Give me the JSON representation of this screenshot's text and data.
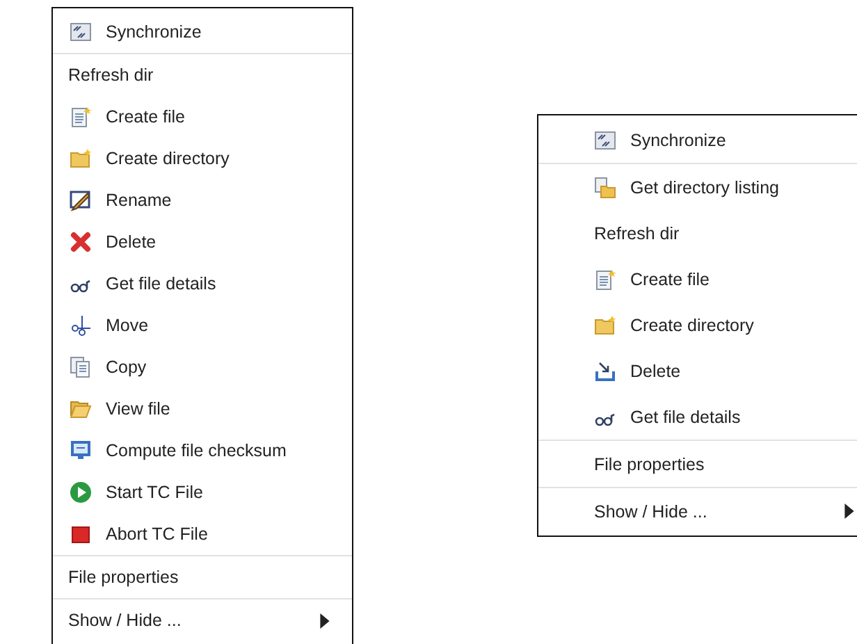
{
  "menus": [
    {
      "sections": [
        [
          {
            "label": "Synchronize",
            "kind": "sync"
          }
        ],
        [
          {
            "label": "Refresh dir"
          },
          {
            "label": "Create file",
            "kind": "newfile"
          },
          {
            "label": "Create directory",
            "kind": "newfolder"
          },
          {
            "label": "Rename",
            "kind": "rename"
          },
          {
            "label": "Delete",
            "kind": "cross"
          },
          {
            "label": "Get file details",
            "kind": "glasses"
          },
          {
            "label": "Move",
            "kind": "scissors"
          },
          {
            "label": "Copy",
            "kind": "copy"
          },
          {
            "label": "View file",
            "kind": "openfolder"
          },
          {
            "label": "Compute file checksum",
            "kind": "monitor"
          },
          {
            "label": "Start TC File",
            "kind": "play"
          },
          {
            "label": "Abort TC File",
            "kind": "stop"
          }
        ],
        [
          {
            "label": "File properties"
          }
        ],
        [
          {
            "label": "Show / Hide ...",
            "submenu": true
          }
        ]
      ]
    },
    {
      "sections": [
        [
          {
            "label": "Synchronize",
            "kind": "sync"
          }
        ],
        [
          {
            "label": "Get directory listing",
            "kind": "listing"
          },
          {
            "label": "Refresh dir"
          },
          {
            "label": "Create file",
            "kind": "newfile"
          },
          {
            "label": "Create directory",
            "kind": "newfolder"
          },
          {
            "label": "Delete",
            "kind": "tray"
          },
          {
            "label": "Get file details",
            "kind": "glasses"
          }
        ],
        [
          {
            "label": "File properties"
          }
        ],
        [
          {
            "label": "Show / Hide ...",
            "submenu": true
          }
        ]
      ]
    }
  ]
}
